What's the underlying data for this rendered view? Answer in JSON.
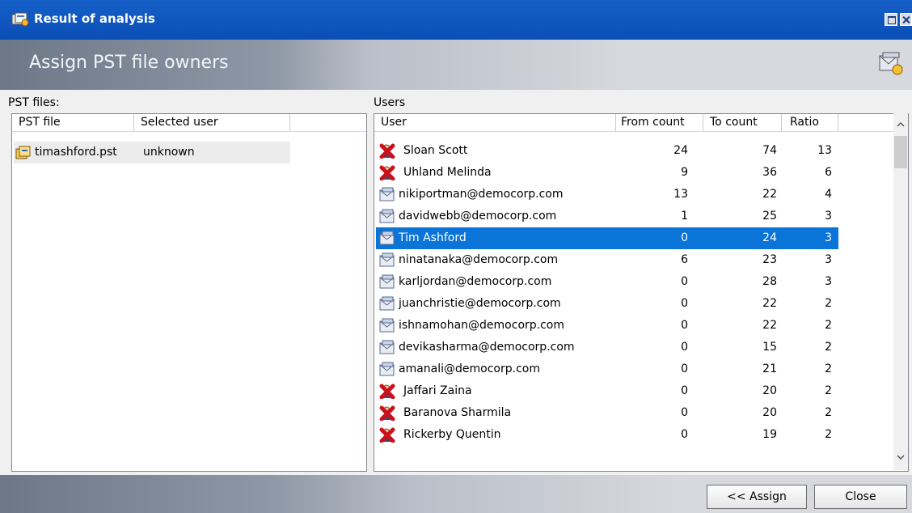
{
  "window": {
    "title": "Result of analysis"
  },
  "header": {
    "title": "Assign PST file owners"
  },
  "pst_panel": {
    "label": "PST files:",
    "columns": [
      "PST file",
      "Selected user"
    ],
    "rows": [
      {
        "file": "timashford.pst",
        "user": "unknown",
        "icon": "pst-file-icon"
      }
    ]
  },
  "users_panel": {
    "label": "Users",
    "columns": [
      "User",
      "From count",
      "To count",
      "Ratio"
    ],
    "rows": [
      {
        "name": "Sloan Scott",
        "from": "24",
        "to": "74",
        "ratio": "13",
        "icon": "red-x-user-icon"
      },
      {
        "name": "Uhland Melinda",
        "from": "9",
        "to": "36",
        "ratio": "6",
        "icon": "red-x-user-icon"
      },
      {
        "name": "nikiportman@democorp.com",
        "from": "13",
        "to": "22",
        "ratio": "4",
        "icon": "mailbox-icon"
      },
      {
        "name": "davidwebb@democorp.com",
        "from": "1",
        "to": "25",
        "ratio": "3",
        "icon": "mailbox-icon"
      },
      {
        "name": "Tim Ashford",
        "from": "0",
        "to": "24",
        "ratio": "3",
        "icon": "mailbox-icon",
        "selected": true
      },
      {
        "name": "ninatanaka@democorp.com",
        "from": "6",
        "to": "23",
        "ratio": "3",
        "icon": "mailbox-icon"
      },
      {
        "name": "karljordan@democorp.com",
        "from": "0",
        "to": "28",
        "ratio": "3",
        "icon": "mailbox-icon"
      },
      {
        "name": "juanchristie@democorp.com",
        "from": "0",
        "to": "22",
        "ratio": "2",
        "icon": "mailbox-icon"
      },
      {
        "name": "ishnamohan@democorp.com",
        "from": "0",
        "to": "22",
        "ratio": "2",
        "icon": "mailbox-icon"
      },
      {
        "name": "devikasharma@democorp.com",
        "from": "0",
        "to": "15",
        "ratio": "2",
        "icon": "mailbox-icon"
      },
      {
        "name": "amanali@democorp.com",
        "from": "0",
        "to": "21",
        "ratio": "2",
        "icon": "mailbox-icon"
      },
      {
        "name": "Jaffari Zaina",
        "from": "0",
        "to": "20",
        "ratio": "2",
        "icon": "red-x-user-icon"
      },
      {
        "name": "Baranova Sharmila",
        "from": "0",
        "to": "20",
        "ratio": "2",
        "icon": "red-x-user-icon"
      },
      {
        "name": "Rickerby Quentin",
        "from": "0",
        "to": "19",
        "ratio": "2",
        "icon": "red-x-user-icon"
      }
    ]
  },
  "buttons": {
    "assign": "<< Assign",
    "close": "Close"
  },
  "colors": {
    "title_bar": "#0a4eb6",
    "selection": "#0a74d8",
    "error_icon": "#c8121c"
  }
}
